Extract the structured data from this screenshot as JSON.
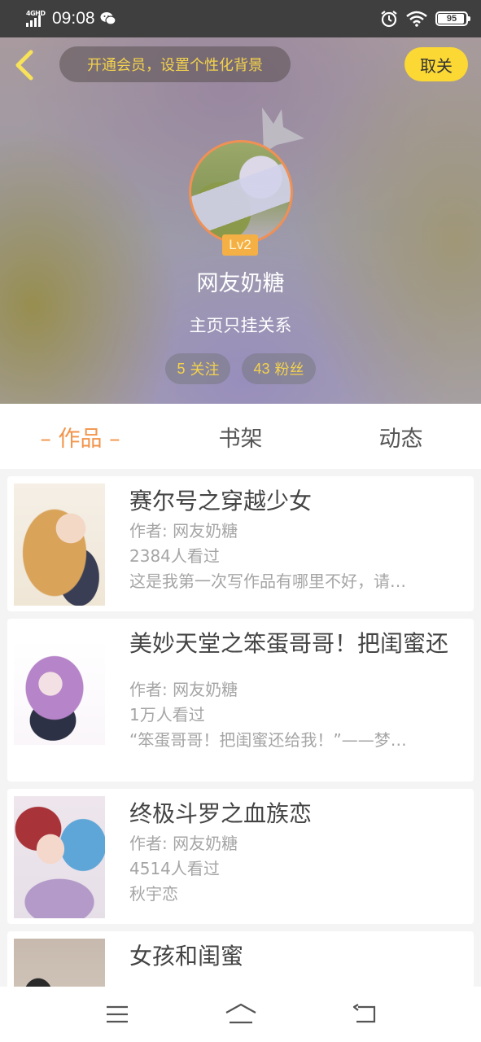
{
  "status_bar": {
    "network": "4GHD",
    "time": "09:08",
    "battery": "95",
    "battery_level": 0.95,
    "icons": [
      "signal-icon",
      "wechat-icon",
      "alarm-icon",
      "wifi-icon",
      "battery-icon"
    ]
  },
  "header": {
    "vip_banner": "开通会员，设置个性化背景",
    "unfollow_label": "取关",
    "level": "Lv2",
    "username": "网友奶糖",
    "bio": "主页只挂关系",
    "following_count": "5",
    "following_label": "关注",
    "followers_count": "43",
    "followers_label": "粉丝"
  },
  "tabs": [
    {
      "label": "– 作品 –",
      "active": true
    },
    {
      "label": "书架",
      "active": false
    },
    {
      "label": "动态",
      "active": false
    }
  ],
  "works": [
    {
      "title": "赛尔号之穿越少女",
      "author": "作者: 网友奶糖",
      "views": "2384人看过",
      "desc": "这是我第一次写作品有哪里不好，请…"
    },
    {
      "title": "美妙天堂之笨蛋哥哥！把闺蜜还",
      "author": "作者: 网友奶糖",
      "views": "1万人看过",
      "desc": "“笨蛋哥哥！把闺蜜还给我！”——梦…"
    },
    {
      "title": "终极斗罗之血族恋",
      "author": "作者: 网友奶糖",
      "views": "4514人看过",
      "desc": "秋宇恋"
    },
    {
      "title": "女孩和闺蜜"
    }
  ],
  "colors": {
    "accent": "#f2944a",
    "vip_text": "#f3d24c",
    "unfollow_bg": "#fbd834",
    "level_badge": "#f5b045",
    "avatar_border": "#f09055"
  }
}
